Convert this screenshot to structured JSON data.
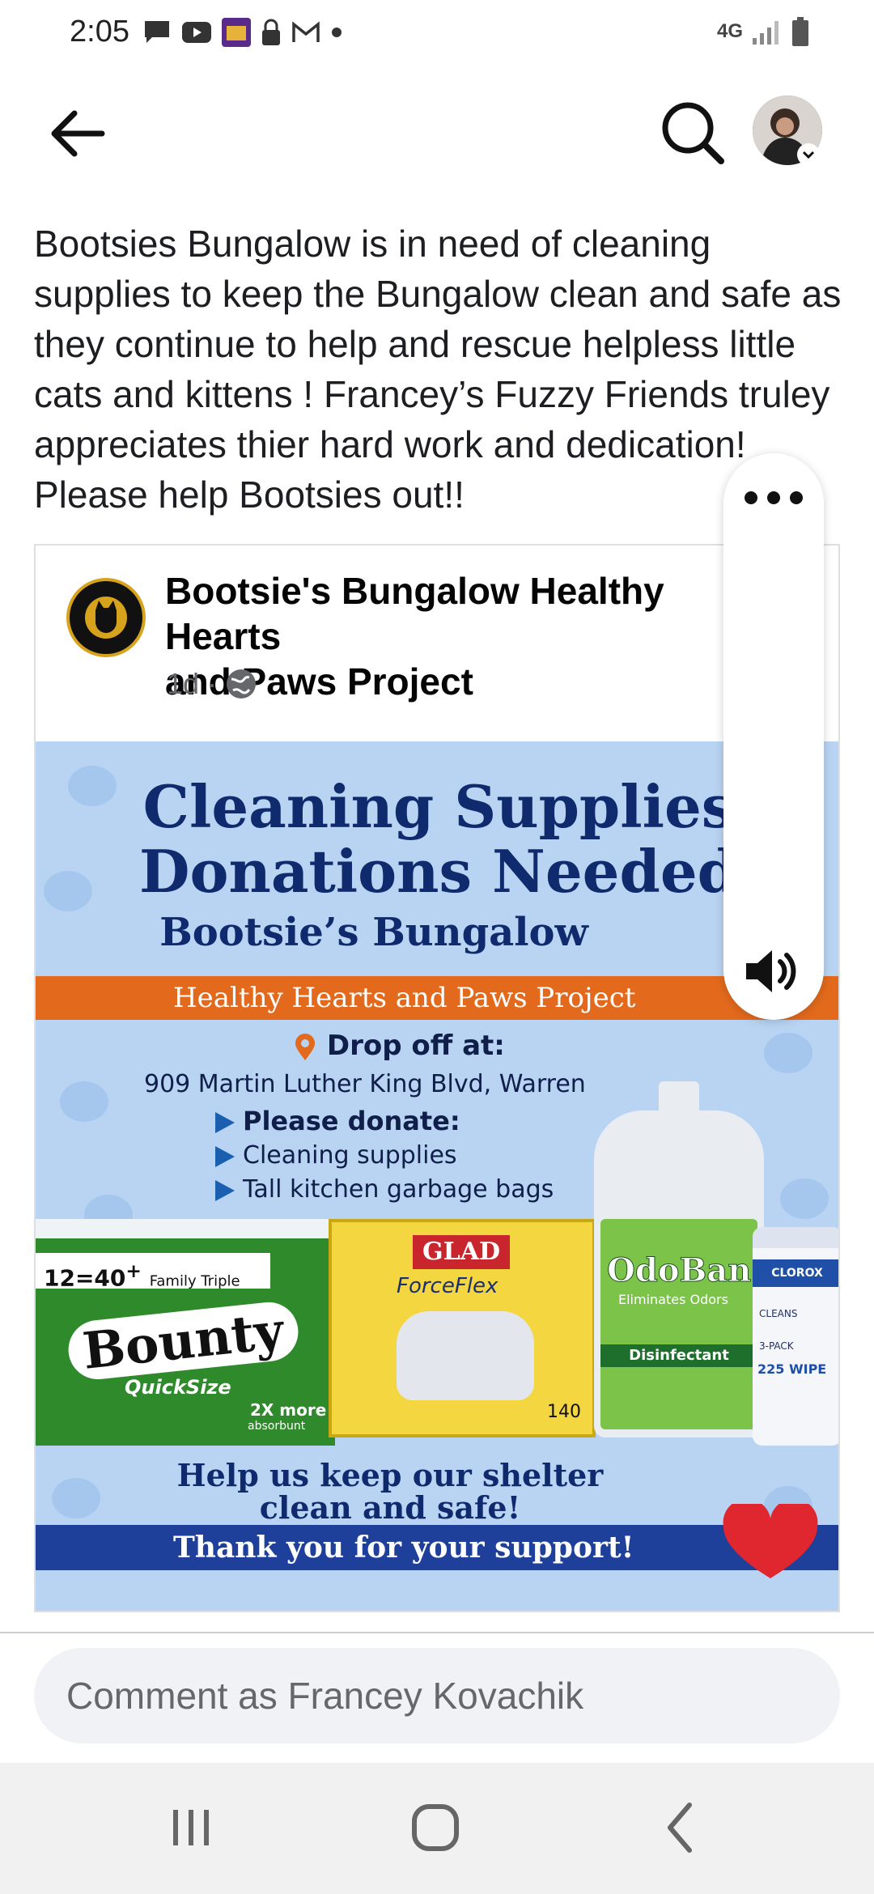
{
  "status_bar": {
    "time": "2:05",
    "network": "4G",
    "icons": [
      "chat-icon",
      "youtube-icon",
      "app-icon",
      "lock-icon",
      "gmail-icon",
      "dot-icon"
    ]
  },
  "app_bar": {
    "back_icon": "back-arrow-icon",
    "search_icon": "search-icon"
  },
  "post": {
    "text": "Bootsies Bungalow is in need of cleaning supplies to keep the Bungalow clean and safe as they continue to help and rescue helpless little cats and kittens ! Francey’s Fuzzy Friends truley appreciates thier hard work and dedication! Please help Bootsies out!!"
  },
  "shared_post": {
    "page_name": "Bootsie's Bungalow Healthy Hearts\nand Paws Project",
    "time": "1d",
    "separator": "·",
    "audience_icon": "globe-icon"
  },
  "flyer": {
    "title_line1": "Cleaning Supplies",
    "title_line2": "Donations Needed",
    "subtitle": "Bootsie’s Bungalow",
    "band": "Healthy Hearts and Paws Project",
    "drop_off": "Drop off at:",
    "address": "909 Martin Luther King Blvd, Warren",
    "donate": "Please donate:",
    "item1": "Cleaning supplies",
    "item2": "Tall kitchen garbage bags",
    "bounty_top": "12=40",
    "bounty_plus": "+",
    "bounty_family": "Family Triple",
    "bounty_brand": "Bounty",
    "bounty_quick": "QuickSize",
    "bounty_more": "2X more",
    "bounty_absorbent": "absorbunt",
    "glad_brand": "GLAD",
    "glad_sub": "ForceFlex",
    "glad_count": "140",
    "odoban_brand": "OdoBan",
    "odoban_sub": "Eliminates Odors",
    "odoban_label": "Disinfectant",
    "clorox_brand": "CLOROX",
    "clorox_clean": "CLEANS",
    "clorox_pack": "3-PACK",
    "clorox_count": "225 WIPE",
    "bottom1": "Help us keep our shelter",
    "bottom2": "clean and safe!",
    "thanks": "Thank you for your support!"
  },
  "side_panel": {
    "more_icon": "more-horizontal-icon",
    "sound_icon": "speaker-icon"
  },
  "comment": {
    "placeholder": "Comment as Francey Kovachik"
  },
  "nav_bar": {
    "items": [
      "recent-apps-icon",
      "home-icon",
      "back-icon"
    ]
  },
  "colors": {
    "flyer_bg": "#b9d4f3",
    "flyer_navy": "#0f2b6e",
    "band_orange": "#e36a1c",
    "thanks_blue": "#1e3f9a",
    "heart_red": "#e0262e"
  }
}
